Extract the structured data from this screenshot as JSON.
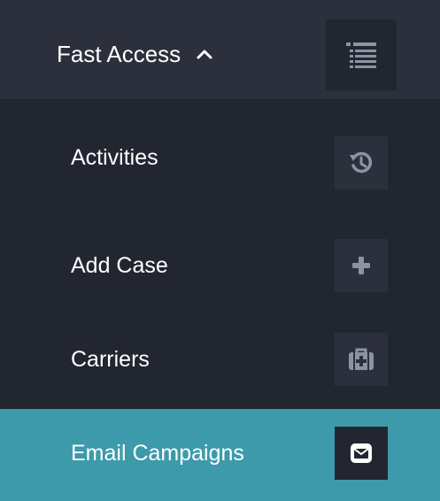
{
  "header": {
    "title": "Fast Access"
  },
  "items": [
    {
      "label": "Activities",
      "icon": "history-icon"
    },
    {
      "label": "Add Case",
      "icon": "plus-icon"
    },
    {
      "label": "Carriers",
      "icon": "medkit-icon"
    },
    {
      "label": "Email Campaigns",
      "icon": "envelope-icon"
    }
  ],
  "colors": {
    "background": "#222630",
    "header_background": "#2c303c",
    "icon_box": "#2c303c",
    "icon_color": "#8e93a3",
    "active_background": "#3d9aab"
  }
}
